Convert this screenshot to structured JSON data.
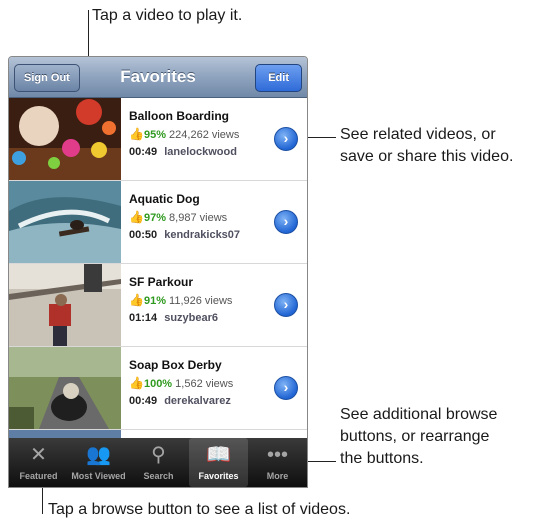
{
  "annotations": {
    "tap_video": "Tap a video to play it.",
    "related_line1": "See related videos, or",
    "related_line2": "save or share this video.",
    "browse_line1": "See additional browse",
    "browse_line2": "buttons, or rearrange",
    "browse_line3": "the buttons.",
    "tap_browse": "Tap a browse button to see a list of videos."
  },
  "navbar": {
    "title": "Favorites",
    "left_button": "Sign Out",
    "right_button": "Edit"
  },
  "videos": [
    {
      "title": "Balloon Boarding",
      "rating": "95%",
      "views": "224,262 views",
      "duration": "00:49",
      "user": "lanelockwood"
    },
    {
      "title": "Aquatic Dog",
      "rating": "97%",
      "views": "8,987 views",
      "duration": "00:50",
      "user": "kendrakicks07"
    },
    {
      "title": "SF Parkour",
      "rating": "91%",
      "views": "11,926 views",
      "duration": "01:14",
      "user": "suzybear6"
    },
    {
      "title": "Soap Box Derby",
      "rating": "100%",
      "views": "1,562 views",
      "duration": "00:49",
      "user": "derekalvarez"
    }
  ],
  "tabs": [
    {
      "label": "Featured",
      "icon": "featured-icon",
      "glyph": "✕"
    },
    {
      "label": "Most Viewed",
      "icon": "most-viewed-icon",
      "glyph": "👥"
    },
    {
      "label": "Search",
      "icon": "search-icon",
      "glyph": "⚲"
    },
    {
      "label": "Favorites",
      "icon": "bookmarks-icon",
      "glyph": "📖"
    },
    {
      "label": "More",
      "icon": "more-icon",
      "glyph": "•••"
    }
  ],
  "colors": {
    "nav_bar": "#8ea3be",
    "edit_button": "#2f6bd8",
    "rating_green": "#2f9a1f",
    "tab_bar": "#1f1f1f"
  }
}
